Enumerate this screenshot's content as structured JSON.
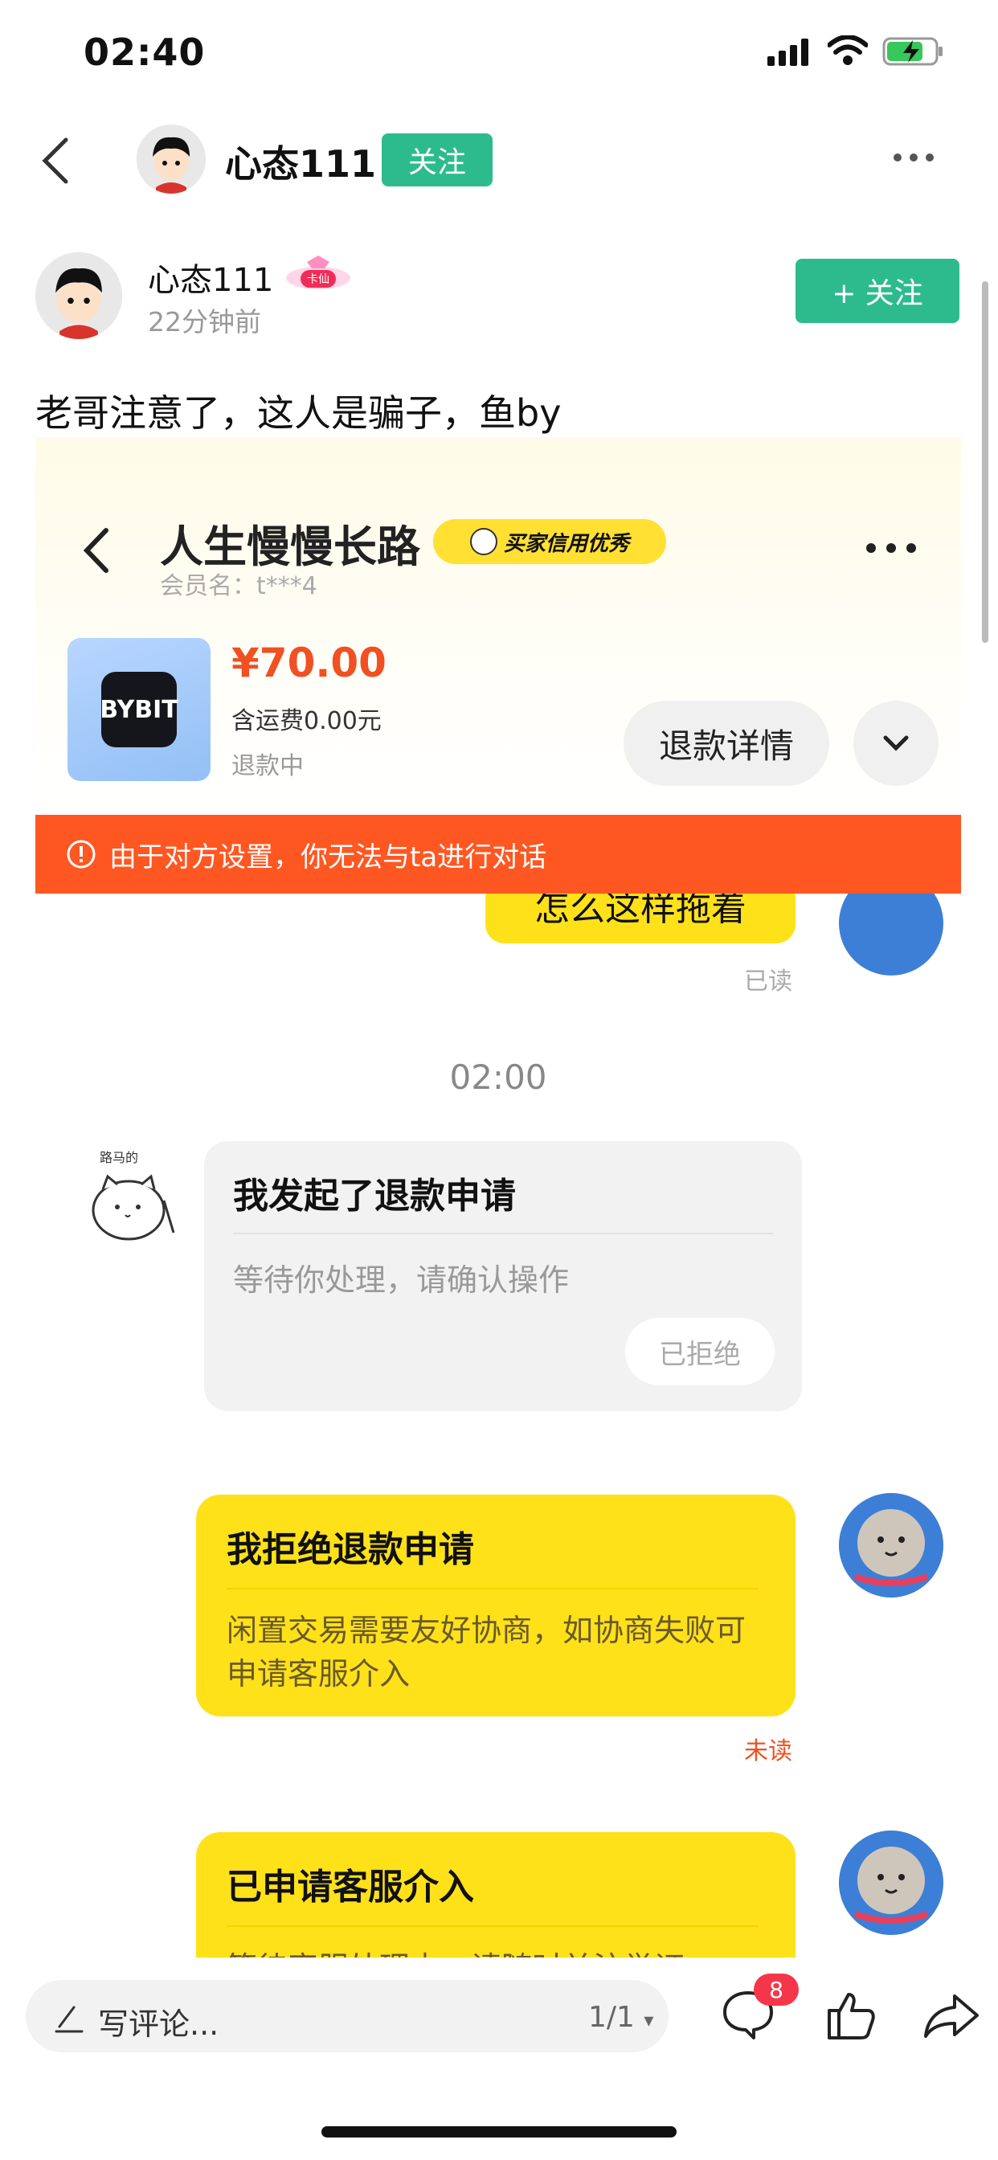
{
  "status_bar": {
    "time": "02:40"
  },
  "nav": {
    "username": "心态111",
    "follow_label": "关注"
  },
  "post": {
    "author": "心态111",
    "badge": "卡仙",
    "time": "22分钟前",
    "follow_label": "+ 关注",
    "text": "老哥注意了，这人是骗子，鱼by"
  },
  "embedded": {
    "seller_name": "人生慢慢长路",
    "credit_badge": "买家信用优秀",
    "member": "会员名：t***4",
    "product": {
      "logo": "BYBIT",
      "price": "¥70.00",
      "shipping": "含运费0.00元",
      "status": "退款中"
    },
    "refund_detail_label": "退款详情",
    "banner": "由于对方设置，你无法与ta进行对话",
    "partial_message": "怎么这样拖着",
    "read_label": "已读",
    "time_divider": "02:00",
    "avatar_left_label": "路马的",
    "card_refund": {
      "title": "我发起了退款申请",
      "text": "等待你处理，请确认操作",
      "button": "已拒绝"
    },
    "card_reject": {
      "title": "我拒绝退款申请",
      "text": "闲置交易需要友好协商，如协商失败可申请客服介入"
    },
    "unread_label": "未读",
    "card_service": {
      "title": "已申请客服介入",
      "text": "等待客服处理中，请随时关注举证"
    }
  },
  "bottom_bar": {
    "comment_placeholder": "写评论...",
    "page_indicator": "1/1",
    "comment_count": "8"
  }
}
